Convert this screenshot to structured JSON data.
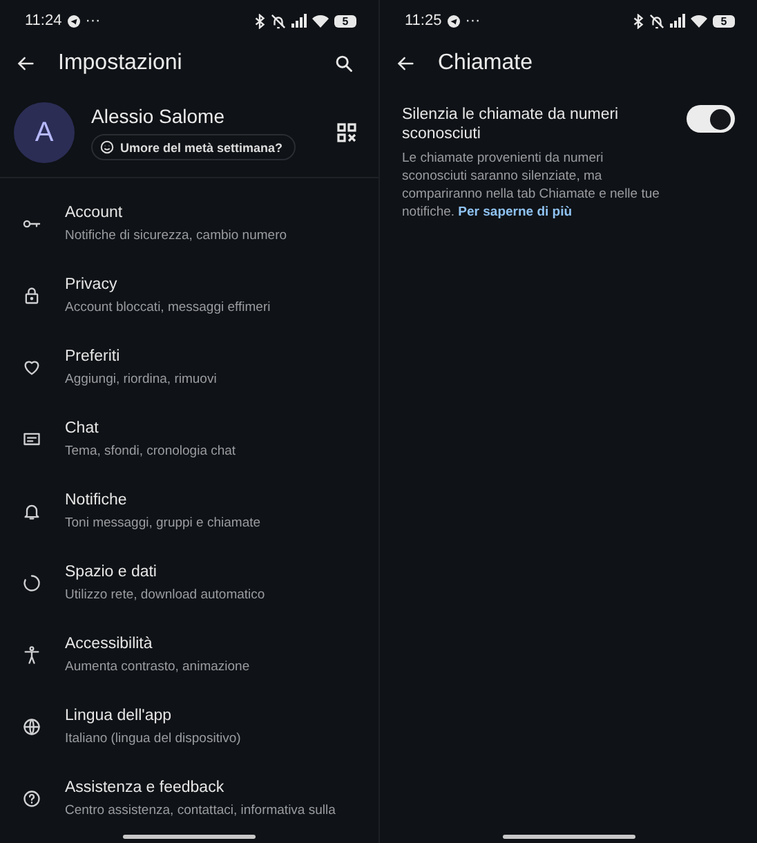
{
  "screens": [
    {
      "status_bar": {
        "time": "11:24",
        "more": "···",
        "battery": "5"
      },
      "header": {
        "title": "Impostazioni"
      },
      "profile": {
        "initial": "A",
        "name": "Alessio Salome",
        "status": "Umore del metà settimana?"
      },
      "items": [
        {
          "kind": "key",
          "title": "Account",
          "subtitle": "Notifiche di sicurezza, cambio numero"
        },
        {
          "kind": "lock",
          "title": "Privacy",
          "subtitle": "Account bloccati, messaggi effimeri"
        },
        {
          "kind": "heart",
          "title": "Preferiti",
          "subtitle": "Aggiungi, riordina, rimuovi"
        },
        {
          "kind": "chat",
          "title": "Chat",
          "subtitle": "Tema, sfondi, cronologia chat"
        },
        {
          "kind": "bell",
          "title": "Notifiche",
          "subtitle": "Toni messaggi, gruppi e chiamate"
        },
        {
          "kind": "storage",
          "title": "Spazio e dati",
          "subtitle": "Utilizzo rete, download automatico"
        },
        {
          "kind": "accessibility",
          "title": "Accessibilità",
          "subtitle": "Aumenta contrasto, animazione"
        },
        {
          "kind": "globe",
          "title": "Lingua dell'app",
          "subtitle": "Italiano (lingua del dispositivo)"
        },
        {
          "kind": "help",
          "title": "Assistenza e feedback",
          "subtitle": "Centro assistenza, contattaci, informativa sulla"
        }
      ]
    },
    {
      "status_bar": {
        "time": "11:25",
        "more": "···",
        "battery": "5"
      },
      "header": {
        "title": "Chiamate"
      },
      "setting": {
        "title": "Silenzia le chiamate da numeri sconosciuti",
        "on": true,
        "description": "Le chiamate provenienti da numeri sconosciuti saranno silenziate, ma compariranno nella tab Chiamate e nelle tue notifiche.",
        "link": "Per saperne di più"
      }
    }
  ]
}
